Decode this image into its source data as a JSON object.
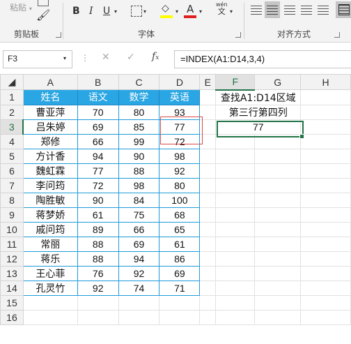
{
  "ribbon": {
    "paste_label": "粘贴",
    "clipboard_group": "剪贴板",
    "font_group": "字体",
    "align_group": "对齐方式",
    "bold": "B",
    "italic": "I",
    "underline": "U",
    "font_color_glyph": "A",
    "wen_top": "wén",
    "wen_bottom": "文"
  },
  "formula_bar": {
    "name_box": "F3",
    "formula": "=INDEX(A1:D14,3,4)"
  },
  "grid": {
    "column_headers": [
      "A",
      "B",
      "C",
      "D",
      "E",
      "F",
      "G",
      "H"
    ],
    "row_headers": [
      "1",
      "2",
      "3",
      "4",
      "5",
      "6",
      "7",
      "8",
      "9",
      "10",
      "11",
      "12",
      "13",
      "14",
      "15",
      "16"
    ],
    "table_headers": [
      "姓名",
      "语文",
      "数学",
      "英语"
    ],
    "rows": [
      [
        "曹亚萍",
        "70",
        "80",
        "93"
      ],
      [
        "吕朱婷",
        "69",
        "85",
        "77"
      ],
      [
        "郑修",
        "66",
        "99",
        "72"
      ],
      [
        "方计香",
        "94",
        "90",
        "98"
      ],
      [
        "魏虹霖",
        "77",
        "88",
        "92"
      ],
      [
        "李问筠",
        "72",
        "98",
        "80"
      ],
      [
        "陶胜敏",
        "90",
        "84",
        "100"
      ],
      [
        "蒋梦娇",
        "61",
        "75",
        "68"
      ],
      [
        "戚问筠",
        "89",
        "66",
        "65"
      ],
      [
        "常丽",
        "88",
        "69",
        "61"
      ],
      [
        "蒋乐",
        "88",
        "94",
        "86"
      ],
      [
        "王心菲",
        "76",
        "92",
        "69"
      ],
      [
        "孔灵竹",
        "92",
        "74",
        "71"
      ]
    ],
    "note_line1": "查找A1:D14区域",
    "note_line2": "第三行第四列",
    "result": "77"
  },
  "colors": {
    "table_header_bg": "#29a6e3",
    "table_border": "#1f9bd8",
    "selection": "#217346",
    "highlight_box": "#d84a4a"
  }
}
